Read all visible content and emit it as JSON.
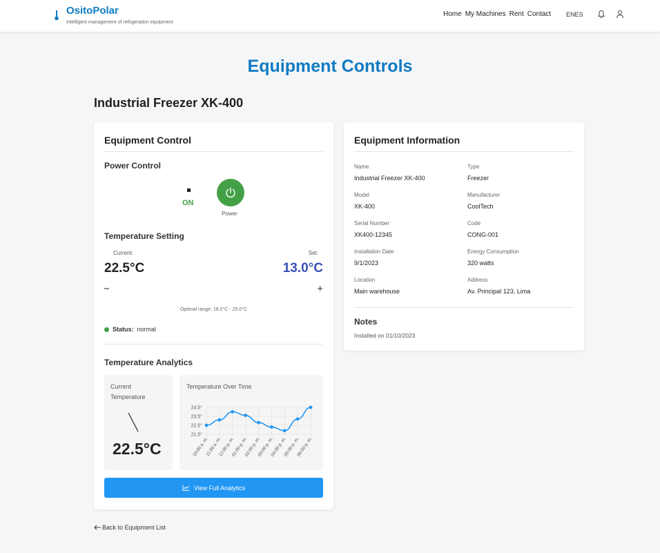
{
  "header": {
    "brand": "OsitoPolar",
    "tagline": "Intelligent management of refrigeration equipment",
    "nav": [
      "Home",
      "My Machines",
      "Rent",
      "Contact"
    ],
    "lang_en": "EN",
    "lang_es": "ES",
    "brand_color": "#0d7bc0"
  },
  "page_title": "Equipment Controls",
  "equipment_title": "Industrial Freezer XK-400",
  "control": {
    "heading": "Equipment Control",
    "power_heading": "Power Control",
    "power_state": "ON",
    "power_label": "Power",
    "temp_heading": "Temperature Setting",
    "current_label": "Current:",
    "current_value": "22.5°C",
    "set_label": "Set:",
    "set_value": "13.0°C",
    "minus": "−",
    "plus": "+",
    "optimal_range": "Optimal range: 18.0°C - 25.0°C",
    "status_label": "Status:",
    "status_value": "normal",
    "analytics_heading": "Temperature Analytics",
    "current_temp_label": "Current Temperature",
    "gauge_value": "22.5°C",
    "chart_title": "Temperature Over Time",
    "button_label": "View Full Analytics",
    "accent_green": "#43a047",
    "accent_blue": "#2196f3",
    "set_color": "#3a4fb5"
  },
  "chart_data": {
    "type": "line",
    "title": "Temperature Over Time",
    "x": [
      "10:00 a. m.",
      "11:00 a. m.",
      "12:00 p. m.",
      "01:00 p. m.",
      "02:00 p. m.",
      "03:00 p. m.",
      "04:00 p. m.",
      "05:00 p. m.",
      "06:00 p. m."
    ],
    "series": [
      {
        "values": [
          22.5,
          23.1,
          24.0,
          23.6,
          22.8,
          22.3,
          21.9,
          23.2,
          24.5
        ]
      }
    ],
    "yticks": [
      "24.5°",
      "23.5°",
      "22.5°",
      "21.5°"
    ],
    "ylim": [
      21.5,
      24.5
    ],
    "grid": true,
    "line_color": "#2196f3"
  },
  "info": {
    "heading": "Equipment Information",
    "fields": [
      {
        "label": "Name",
        "value": "Industrial Freezer XK-400"
      },
      {
        "label": "Type",
        "value": "Freezer"
      },
      {
        "label": "Model",
        "value": "XK-400"
      },
      {
        "label": "Manufacturer",
        "value": "CoolTech"
      },
      {
        "label": "Serial Number",
        "value": "XK400-12345"
      },
      {
        "label": "Code",
        "value": "CONG-001"
      },
      {
        "label": "Installation Date",
        "value": "9/1/2023"
      },
      {
        "label": "Energy Consumption",
        "value": "320 watts"
      },
      {
        "label": "Location",
        "value": "Main warehouse"
      },
      {
        "label": "Address",
        "value": "Av. Principal 123, Lima"
      }
    ],
    "notes_heading": "Notes",
    "notes_text": "Installed on 01/10/2023"
  },
  "back_link": "Back to Equipment List"
}
